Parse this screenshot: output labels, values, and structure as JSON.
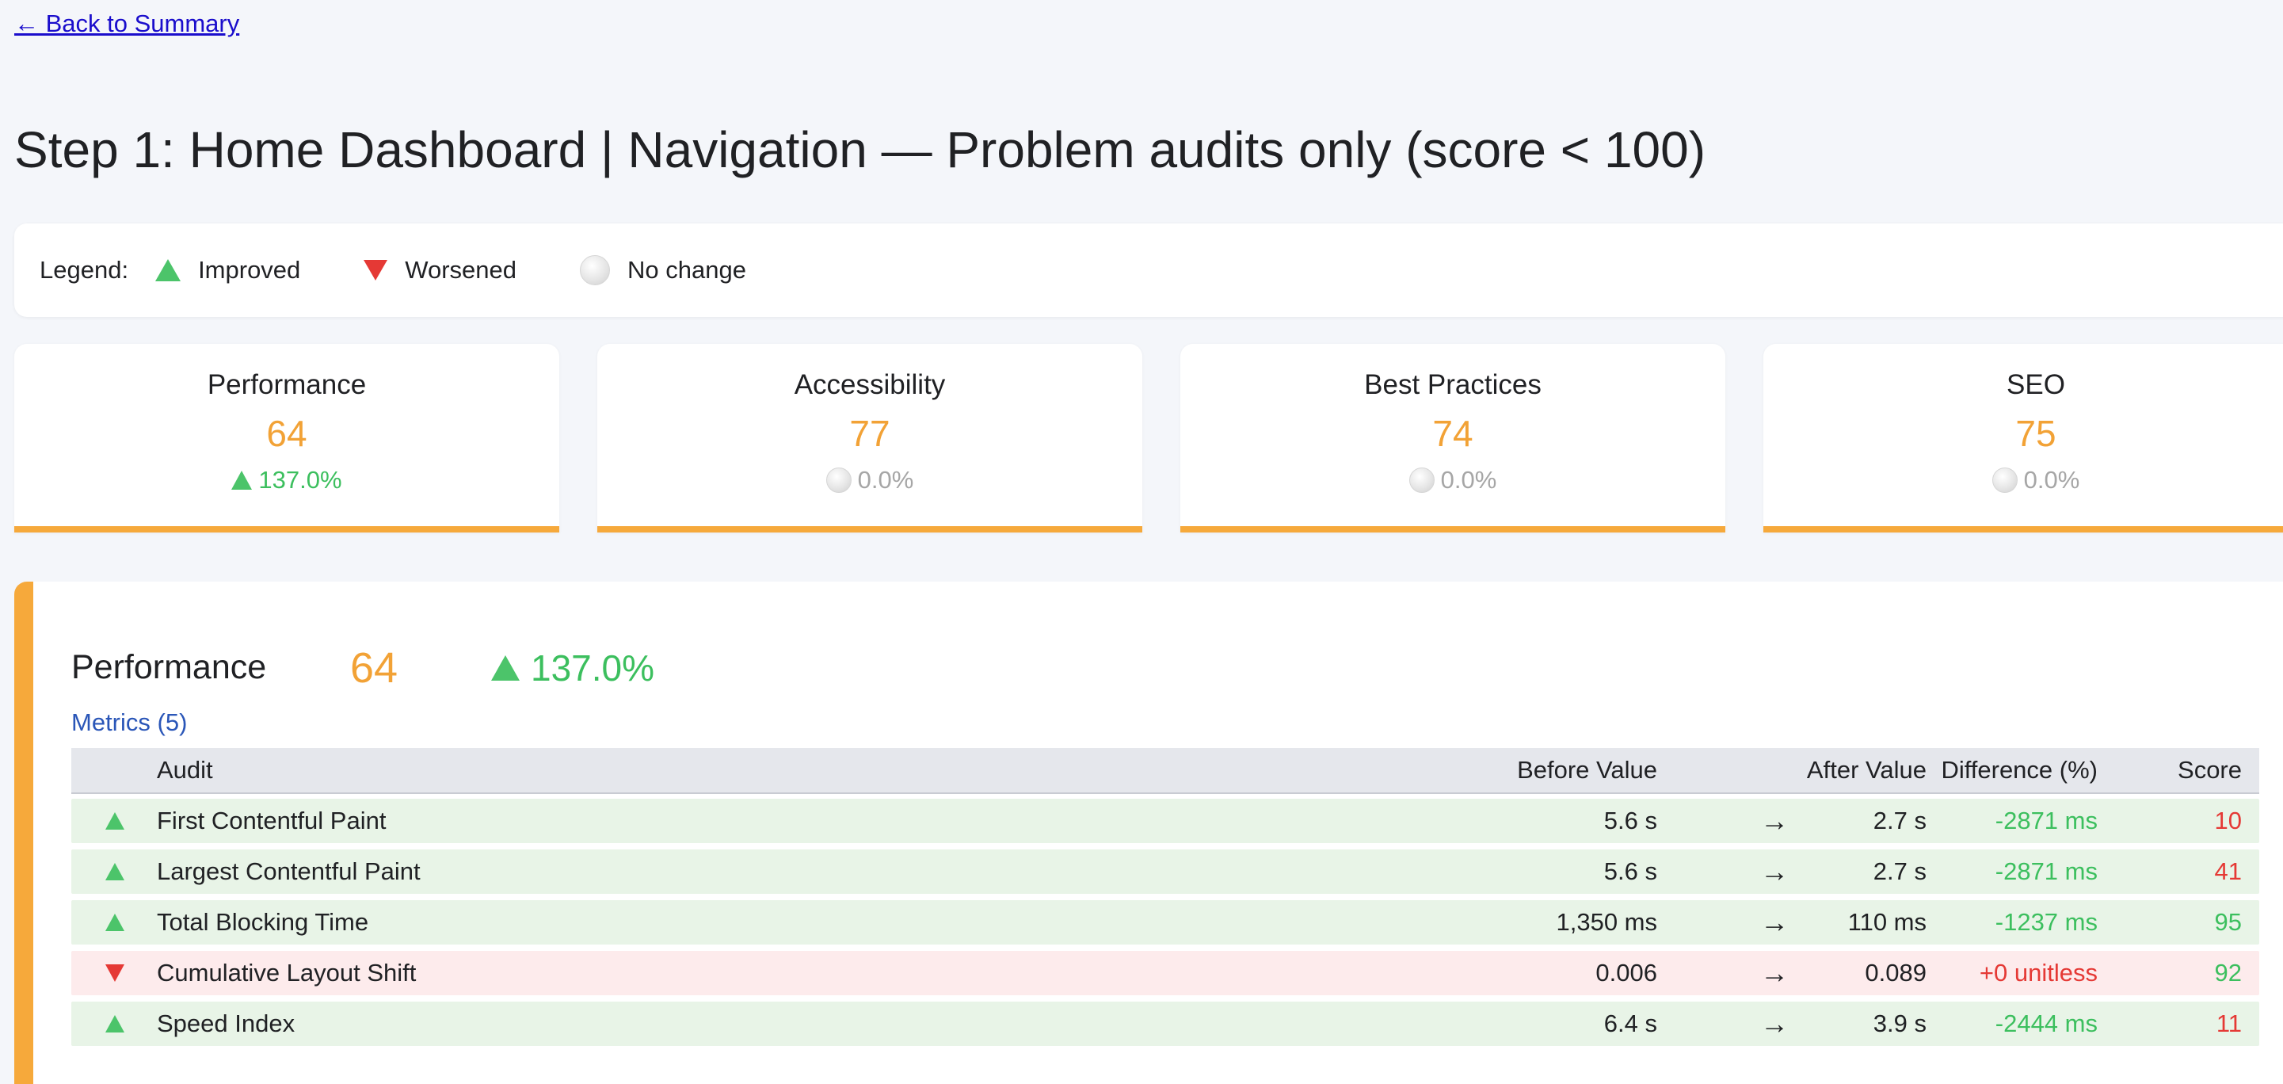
{
  "nav": {
    "back_label": "← Back to Summary"
  },
  "page_title": "Step 1: Home Dashboard | Navigation — Problem audits only (score < 100)",
  "legend": {
    "label": "Legend:",
    "improved": "Improved",
    "worsened": "Worsened",
    "no_change": "No change"
  },
  "colors": {
    "accent_orange": "#f6a93b",
    "score_orange": "#f2a236",
    "improved_green": "#3cbf5e",
    "worsened_red": "#e53935",
    "link_blue": "#1a0dcc"
  },
  "cards": [
    {
      "name": "Performance",
      "score": "64",
      "change": "137.0%",
      "trend": "up"
    },
    {
      "name": "Accessibility",
      "score": "77",
      "change": "0.0%",
      "trend": "none"
    },
    {
      "name": "Best Practices",
      "score": "74",
      "change": "0.0%",
      "trend": "none"
    },
    {
      "name": "SEO",
      "score": "75",
      "change": "0.0%",
      "trend": "none"
    }
  ],
  "section": {
    "name": "Performance",
    "score": "64",
    "change": "137.0%",
    "metrics_label": "Metrics (5)",
    "columns": {
      "audit": "Audit",
      "before": "Before Value",
      "after": "After Value",
      "difference": "Difference (%)",
      "score": "Score"
    },
    "arrow": "→",
    "rows": [
      {
        "trend": "up",
        "audit": "First Contentful Paint",
        "before": "5.6 s",
        "after": "2.7 s",
        "difference": "-2871 ms",
        "diff_trend": "good",
        "score": "10",
        "score_color": "red"
      },
      {
        "trend": "up",
        "audit": "Largest Contentful Paint",
        "before": "5.6 s",
        "after": "2.7 s",
        "difference": "-2871 ms",
        "diff_trend": "good",
        "score": "41",
        "score_color": "red"
      },
      {
        "trend": "up",
        "audit": "Total Blocking Time",
        "before": "1,350 ms",
        "after": "110 ms",
        "difference": "-1237 ms",
        "diff_trend": "good",
        "score": "95",
        "score_color": "green"
      },
      {
        "trend": "down",
        "audit": "Cumulative Layout Shift",
        "before": "0.006",
        "after": "0.089",
        "difference": "+0 unitless",
        "diff_trend": "bad",
        "score": "92",
        "score_color": "green"
      },
      {
        "trend": "up",
        "audit": "Speed Index",
        "before": "6.4 s",
        "after": "3.9 s",
        "difference": "-2444 ms",
        "diff_trend": "good",
        "score": "11",
        "score_color": "red"
      }
    ]
  }
}
